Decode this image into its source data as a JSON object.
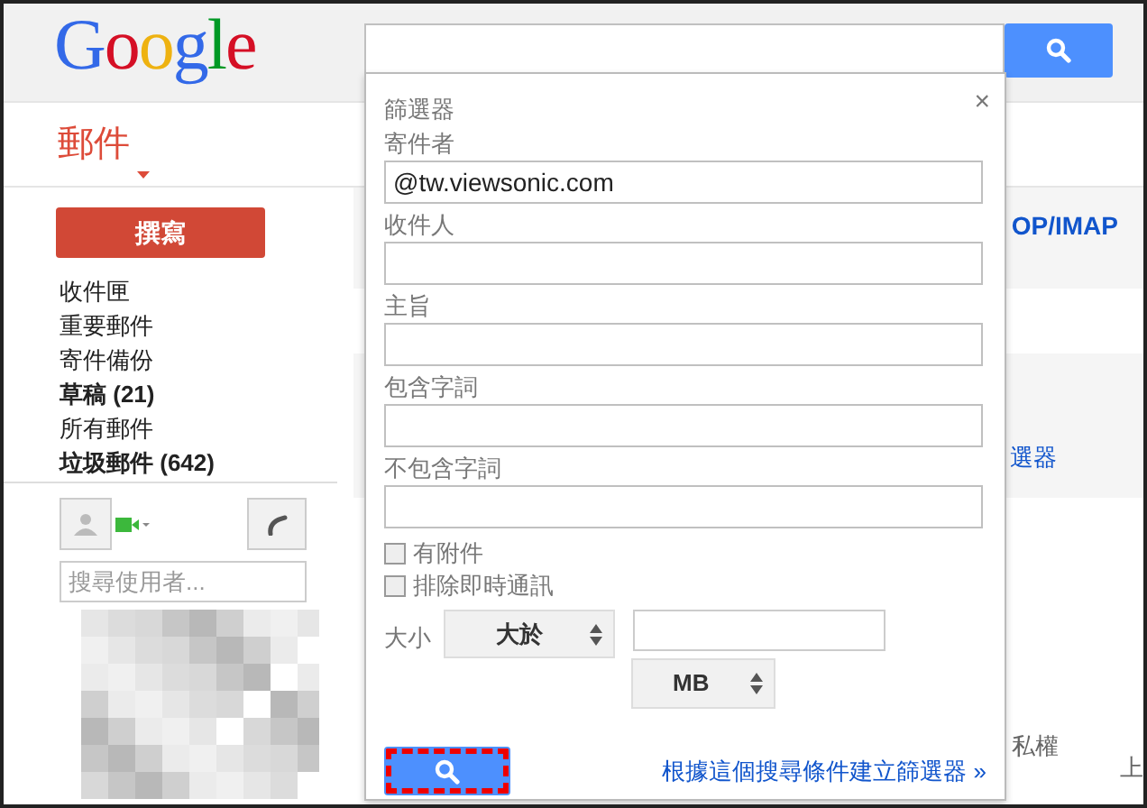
{
  "header": {
    "logo": "Google"
  },
  "app_switch": {
    "label": "郵件"
  },
  "compose": {
    "label": "撰寫"
  },
  "folders": [
    {
      "label": "收件匣",
      "bold": false
    },
    {
      "label": "重要郵件",
      "bold": false
    },
    {
      "label": "寄件備份",
      "bold": false
    },
    {
      "label": "草稿 (21)",
      "bold": true
    },
    {
      "label": "所有郵件",
      "bold": false
    },
    {
      "label": "垃圾郵件 (642)",
      "bold": true
    }
  ],
  "chat": {
    "search_placeholder": "搜尋使用者..."
  },
  "background": {
    "links": [
      "OP/IMAP",
      "選器"
    ],
    "texts": [
      "私權",
      "上"
    ]
  },
  "filter_popup": {
    "title": "篩選器",
    "close": "×",
    "fields": [
      {
        "label": "寄件者",
        "value": "@tw.viewsonic.com"
      },
      {
        "label": "收件人"
      },
      {
        "label": "主旨"
      },
      {
        "label": "包含字詞"
      },
      {
        "label": "不包含字詞"
      }
    ],
    "checkboxes": [
      {
        "label": "有附件",
        "checked": false
      },
      {
        "label": "排除即時通訊",
        "checked": false
      }
    ],
    "size": {
      "label": "大小",
      "operator": "大於",
      "unit": "MB"
    },
    "search_button": {
      "highlighted": true
    },
    "create_filter_link": "根據這個搜尋條件建立篩選器 »"
  }
}
